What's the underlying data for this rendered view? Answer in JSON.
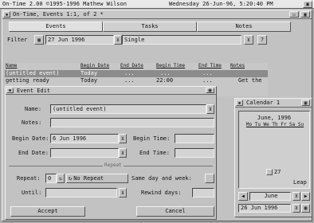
{
  "screen_bar": {
    "title": "On-Time 2.00 ©1995-1996 Mathew Wilson",
    "datetime": "Wednesday 26-Jun-96, 5:20:40 PM"
  },
  "main_window": {
    "title": "On-Time, Events 1:1, of 2 *",
    "tabs": [
      {
        "label": "Events",
        "active": true
      },
      {
        "label": "Tasks",
        "active": false
      },
      {
        "label": "Notes",
        "active": false
      }
    ],
    "filter_label": "Filter",
    "filter_date": "27 Jun 1996",
    "filter_mode": "Single",
    "help_label": "?",
    "columns": [
      "Name",
      "Begin Date",
      "End Date",
      "Begin Time",
      "End Time",
      "Notes"
    ],
    "rows": [
      {
        "name": "(untitled event)",
        "begin_date": "Today",
        "end_date": "...",
        "begin_time": "...",
        "end_time": "...",
        "notes": "",
        "selected": true
      },
      {
        "name": "getting ready",
        "begin_date": "Today",
        "end_date": "...",
        "begin_time": "22:00",
        "end_time": "...",
        "notes": "Get the",
        "selected": false
      }
    ]
  },
  "event_edit": {
    "title": "Event Edit",
    "name_label": "Name:",
    "name_value": "(untitled event)",
    "notes_label": "Notes:",
    "notes_value": "",
    "begin_date_label": "Begin Date:",
    "begin_date_value": "6 Jun 1996",
    "begin_time_label": "Begin Time:",
    "begin_time_value": "",
    "end_date_label": "End Date:",
    "end_date_value": "",
    "end_time_label": "End Time:",
    "end_time_value": "",
    "repeat_section": "Repeat",
    "repeat_label": "Repeat:",
    "repeat_count": "0",
    "repeat_mode": "No Repeat",
    "same_day_label": "Same day and week:",
    "until_label": "Until:",
    "until_value": "",
    "rewind_label": "Rewind days:",
    "rewind_value": "",
    "accept_label": "Accept",
    "cancel_label": "Cancel"
  },
  "calendar": {
    "title": "Calendar 1",
    "month_year": "June, 1996",
    "weekdays": "Mo Tu We Th Fr Sa Su",
    "day_shown": "27",
    "leap_label": "Leap",
    "month_select": "June",
    "date_value": "26 Jun 1996"
  },
  "colors": {
    "desktop": "#a9a9a9",
    "panel": "#c2c2c2",
    "selection": "#8c8c8c"
  }
}
